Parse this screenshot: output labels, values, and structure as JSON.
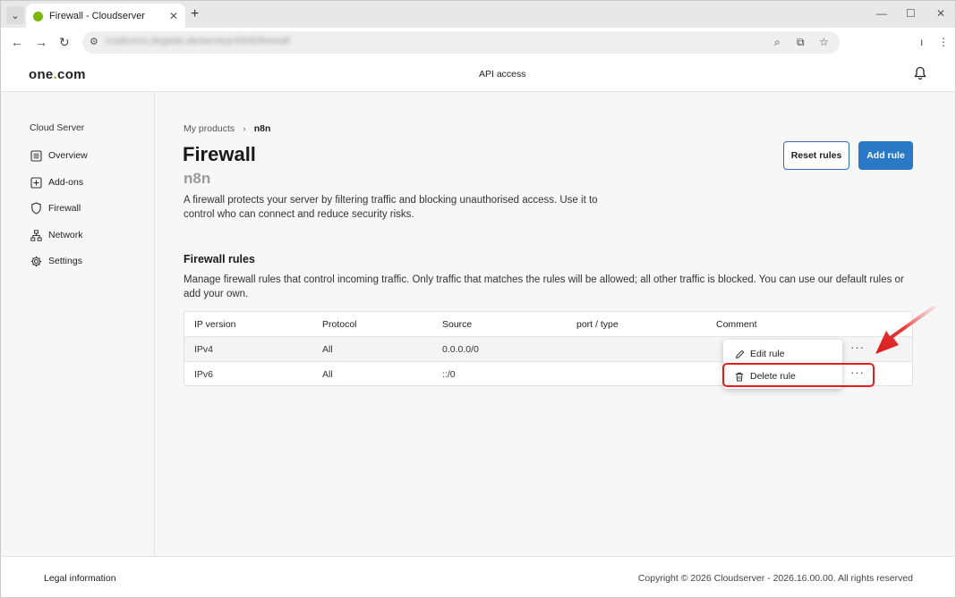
{
  "browser": {
    "tab_title": "Firewall - Cloudserver",
    "tab_close": "✕",
    "new_tab": "+",
    "url_blurred": "cradcoms.dogado.de/service/4006/firewall",
    "menu_glyph": "⌄"
  },
  "header": {
    "logo_part1": "one",
    "logo_dot": ".",
    "logo_part2": "com",
    "api_access": "API access"
  },
  "sidebar": {
    "title": "Cloud Server",
    "items": [
      {
        "label": "Overview",
        "icon": "list-icon"
      },
      {
        "label": "Add-ons",
        "icon": "plus-square-icon"
      },
      {
        "label": "Firewall",
        "icon": "shield-icon"
      },
      {
        "label": "Network",
        "icon": "network-icon"
      },
      {
        "label": "Settings",
        "icon": "gear-icon"
      }
    ]
  },
  "main": {
    "breadcrumb": {
      "parent": "My products",
      "separator": "›",
      "current": "n8n"
    },
    "title": "Firewall",
    "subtitle": "n8n",
    "description": "A firewall protects your server by filtering traffic and blocking unauthorised access. Use it to control who can connect and reduce security risks.",
    "reset_button": "Reset rules",
    "add_button": "Add rule",
    "rules_title": "Firewall rules",
    "rules_description": "Manage firewall rules that control incoming traffic. Only traffic that matches the rules will be allowed; all other traffic is blocked. You can use our default rules or add your own.",
    "table": {
      "columns": [
        "IP version",
        "Protocol",
        "Source",
        "port / type",
        "Comment"
      ],
      "rows": [
        {
          "ip": "IPv4",
          "protocol": "All",
          "source": "0.0.0.0/0",
          "port": "",
          "comment": ""
        },
        {
          "ip": "IPv6",
          "protocol": "All",
          "source": "::/0",
          "port": "",
          "comment": ""
        }
      ],
      "more_glyph": "···"
    },
    "context_menu": {
      "edit": "Edit rule",
      "delete": "Delete rule"
    }
  },
  "footer": {
    "legal": "Legal information",
    "copyright": "Copyright © 2026 Cloudserver - 2026.16.00.00. All rights reserved"
  },
  "colors": {
    "accent": "#2a79c7",
    "brand_green": "#7ab800",
    "highlight_red": "#e41d1d"
  }
}
